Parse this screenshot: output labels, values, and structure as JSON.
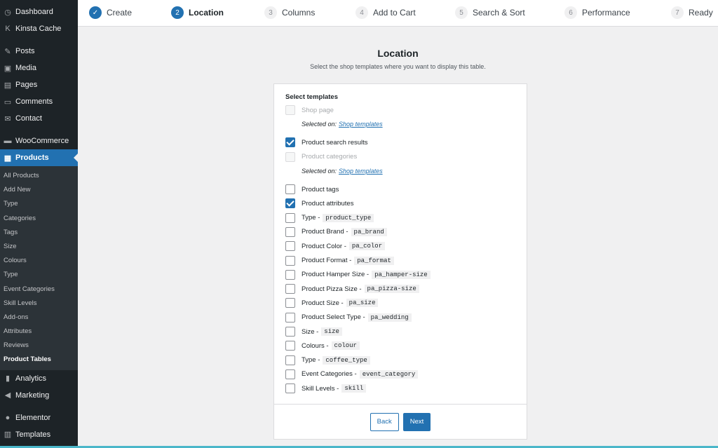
{
  "sidebar": {
    "top_items": [
      {
        "label": "Dashboard",
        "icon": "dashboard-icon"
      },
      {
        "label": "Kinsta Cache",
        "icon": "kinsta-icon"
      }
    ],
    "main_items": [
      {
        "label": "Posts",
        "icon": "pin-icon"
      },
      {
        "label": "Media",
        "icon": "media-icon"
      },
      {
        "label": "Pages",
        "icon": "page-icon"
      },
      {
        "label": "Comments",
        "icon": "comment-icon"
      },
      {
        "label": "Contact",
        "icon": "mail-icon"
      }
    ],
    "woo_items": [
      {
        "label": "WooCommerce",
        "icon": "woocommerce-icon"
      },
      {
        "label": "Products",
        "icon": "products-icon",
        "active": true
      }
    ],
    "submenu": [
      "All Products",
      "Add New",
      "Type",
      "Categories",
      "Tags",
      "Size",
      "Colours",
      "Type",
      "Event Categories",
      "Skill Levels",
      "Add-ons",
      "Attributes",
      "Reviews",
      "Product Tables"
    ],
    "submenu_current": "Product Tables",
    "bottom_items": [
      {
        "label": "Analytics",
        "icon": "analytics-icon"
      },
      {
        "label": "Marketing",
        "icon": "megaphone-icon"
      }
    ],
    "last_items": [
      {
        "label": "Elementor",
        "icon": "elementor-icon"
      },
      {
        "label": "Templates",
        "icon": "templates-icon"
      }
    ]
  },
  "steps": [
    {
      "num": "✓",
      "label": "Create",
      "state": "done"
    },
    {
      "num": "2",
      "label": "Location",
      "state": "current"
    },
    {
      "num": "3",
      "label": "Columns",
      "state": "todo"
    },
    {
      "num": "4",
      "label": "Add to Cart",
      "state": "todo"
    },
    {
      "num": "5",
      "label": "Search & Sort",
      "state": "todo"
    },
    {
      "num": "6",
      "label": "Performance",
      "state": "todo"
    },
    {
      "num": "7",
      "label": "Ready",
      "state": "todo"
    }
  ],
  "page": {
    "title": "Location",
    "subtitle": "Select the shop templates where you want to display this table."
  },
  "card": {
    "heading": "Select templates",
    "selected_on_label": "Selected on:",
    "shop_templates_link": "Shop templates",
    "options": [
      {
        "label": "Shop page",
        "state": "disabled",
        "note": true
      },
      {
        "label": "Product search results",
        "state": "checked",
        "gap_before": true
      },
      {
        "label": "Product categories",
        "state": "disabled",
        "note": true
      },
      {
        "label": "Product tags",
        "state": "unchecked",
        "gap_before": true
      },
      {
        "label": "Product attributes",
        "state": "checked"
      },
      {
        "label": "Type -",
        "code": "product_type",
        "state": "unchecked"
      },
      {
        "label": "Product Brand -",
        "code": "pa_brand",
        "state": "unchecked"
      },
      {
        "label": "Product Color -",
        "code": "pa_color",
        "state": "unchecked"
      },
      {
        "label": "Product Format -",
        "code": "pa_format",
        "state": "unchecked"
      },
      {
        "label": "Product Hamper Size -",
        "code": "pa_hamper-size",
        "state": "unchecked"
      },
      {
        "label": "Product Pizza Size -",
        "code": "pa_pizza-size",
        "state": "unchecked"
      },
      {
        "label": "Product Size -",
        "code": "pa_size",
        "state": "unchecked"
      },
      {
        "label": "Product Select Type -",
        "code": "pa_wedding",
        "state": "unchecked"
      },
      {
        "label": "Size -",
        "code": "size",
        "state": "unchecked"
      },
      {
        "label": "Colours -",
        "code": "colour",
        "state": "unchecked"
      },
      {
        "label": "Type -",
        "code": "coffee_type",
        "state": "unchecked"
      },
      {
        "label": "Event Categories -",
        "code": "event_category",
        "state": "unchecked"
      },
      {
        "label": "Skill Levels -",
        "code": "skill",
        "state": "unchecked"
      }
    ],
    "back_label": "Back",
    "next_label": "Next"
  },
  "colors": {
    "accent": "#2271b1",
    "sidebar_bg": "#1d2327"
  }
}
